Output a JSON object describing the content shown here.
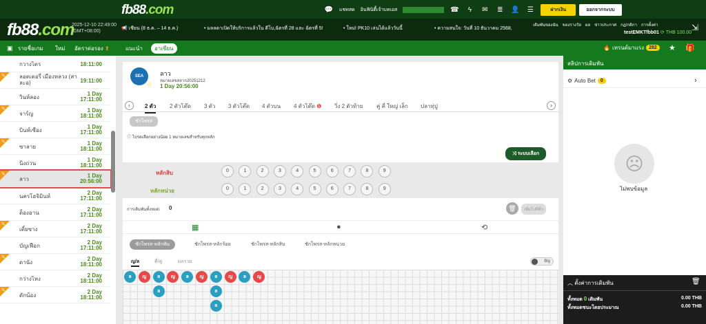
{
  "topbar": {
    "logo_main": "fb88",
    "logo_suffix": ".com",
    "links": [
      "แชทสด",
      "อินฟินิตี้เจ้าบทเอส",
      "",
      "",
      "",
      "",
      ""
    ],
    "deposit_label": "ฝากเงิน",
    "logout_label": "ออกจากระบบ"
  },
  "header": {
    "logo_main": "fb88",
    "logo_suffix": ".com",
    "datetime": "2025-12-10 22:49:00",
    "timezone": "(GMT+08:00)",
    "news": [
      "เชียน (8 ธ.ค. – 14 ธ.ค.)",
      "มลลดาเปิดให้บริการแล้วใน ดีโบ,ฉัตรที่ 28 และ ฉัตรที่ 5!",
      "ใหม่! PK10 เล่นได้แล้ววันนี้",
      "ความสนใจ: วันที่ 10 ธันวาคม 2568,"
    ],
    "user_links": [
      "เดิมพันของฉัน",
      "ของรางวัล",
      "ผล",
      "ข่าวประกาศ",
      "กฎ/กติกา",
      "การตั้งค่า"
    ],
    "username": "testEMKTfbb01",
    "balance": "THB 100.00"
  },
  "nav": {
    "items": [
      "รายชื่อเกม",
      "ใหม่",
      "อัตราต่อรอง",
      "แนะนำ",
      "อาเซียน"
    ],
    "hot_label": "เทรนด์มาแรง",
    "hot_count": "282"
  },
  "sidebar": {
    "items": [
      {
        "name": "กวางไตร",
        "time": "18:11:00",
        "day": "",
        "flag": false
      },
      {
        "name": "ลอตเตอรี่ เมืองหลวง (สาละอ)",
        "time": "19:11:00",
        "day": "",
        "flag": true
      },
      {
        "name": "วินห์ลอง",
        "time": "17:11:00",
        "day": "1 Day",
        "flag": false
      },
      {
        "name": "จาร์ญ",
        "time": "18:11:00",
        "day": "1 Day",
        "flag": true
      },
      {
        "name": "บินห์เซือง",
        "time": "17:11:00",
        "day": "1 Day",
        "flag": false
      },
      {
        "name": "ซาลาย",
        "time": "18:11:00",
        "day": "1 Day",
        "flag": true
      },
      {
        "name": "นิงถ่วน",
        "time": "18:11:00",
        "day": "1 Day",
        "flag": false
      },
      {
        "name": "ลาว",
        "time": "20:56:00",
        "day": "1 Day",
        "flag": true
      },
      {
        "name": "นครโฮจิมินห์",
        "time": "17:11:00",
        "day": "2 Day",
        "flag": false
      },
      {
        "name": "ด็องอาน",
        "time": "17:11:00",
        "day": "2 Day",
        "flag": false
      },
      {
        "name": "เตี๋ยซาง",
        "time": "17:11:00",
        "day": "2 Day",
        "flag": true
      },
      {
        "name": "บัญเฟือก",
        "time": "17:11:00",
        "day": "2 Day",
        "flag": false
      },
      {
        "name": "ดานัง",
        "time": "18:11:00",
        "day": "2 Day",
        "flag": true
      },
      {
        "name": "กว่างไหง",
        "time": "18:11:00",
        "day": "2 Day",
        "flag": false
      },
      {
        "name": "ดักน้อง",
        "time": "18:11:00",
        "day": "2 Day",
        "flag": true
      }
    ]
  },
  "main": {
    "lotto_logo": "SEA",
    "lotto_name": "ลาว",
    "round": "หมายเลขสลาก20251212",
    "countdown": "1 Day 20:56:00",
    "tabs": [
      "2 ตัว",
      "2 ตัวโต๊ด",
      "3 ตัว",
      "3 ตัวโต๊ด",
      "4 ตัวบน",
      "4 ตัวโต๊ด",
      "วิ่ง 2 ตัวท้าย",
      "คู่ คี่ ใหญ่ เล็ก",
      "ปลาทุ่ปู"
    ],
    "chip_label": "ชักไพร่ส",
    "info": "โปรดเลือกอย่างน้อย 1 หมายเลขสำหรับทุกหลัก",
    "random_label": "ระบบเลือก",
    "rows": [
      {
        "label": "หลักสิบ",
        "color": "#d94040"
      },
      {
        "label": "หลักหน่วย",
        "color": "#7aa82b"
      }
    ],
    "digits": [
      "0",
      "1",
      "2",
      "3",
      "4",
      "5",
      "6",
      "7",
      "8",
      "9"
    ],
    "total_label": "การเดิมพันทั้งหมด:",
    "total_value": "0",
    "add_slip_label": "เพิ่มไปที่ตั๋ว",
    "subtabs": [
      "ชักไพร่ส-หลักพัน",
      "ชักไพร่ส-หลักร้อย",
      "ชักไพร่ส-หลักสิบ",
      "ชักไพร่ส-หลักหน่วย"
    ],
    "filters": [
      "ญ/ล",
      "คี่/คู่",
      "ผลรวม"
    ],
    "toggle_label": "Big",
    "beads": [
      [
        {
          "t": "ล",
          "c": "o"
        }
      ],
      [
        {
          "t": "ญ",
          "c": "e"
        }
      ],
      [
        {
          "t": "ล",
          "c": "o"
        },
        {
          "t": "ล",
          "c": "o"
        }
      ],
      [
        {
          "t": "ญ",
          "c": "e"
        }
      ],
      [
        {
          "t": "ล",
          "c": "o"
        }
      ],
      [
        {
          "t": "ญ",
          "c": "e"
        }
      ],
      [
        {
          "t": "ล",
          "c": "o"
        },
        {
          "t": "ล",
          "c": "o"
        },
        {
          "t": "ล",
          "c": "o"
        }
      ],
      [
        {
          "t": "ญ",
          "c": "e"
        }
      ],
      [
        {
          "t": "ล",
          "c": "o"
        }
      ],
      [
        {
          "t": "ญ",
          "c": "e"
        }
      ]
    ]
  },
  "right_panel": {
    "title": "สลิปการเดิมพัน",
    "autobet_label": "Auto Bet",
    "autobet_count": "0",
    "empty_label": "ไม่พบข้อมูล"
  },
  "bet_settings": {
    "title": "ตั้งค่าการเดิมพัน",
    "total_label": "ทั้งหมด",
    "total_count": "0",
    "total_suffix": "เดิมพัน",
    "total_value": "0.00 THB",
    "estimate_label": "ทั้งหมดชนะโดยประมาณ",
    "estimate_value": "0.00 THB"
  },
  "colors": {
    "header_green": "#0b2a0e",
    "nav_green": "#157a1e",
    "accent_yellow": "#f5d300",
    "bead_blue": "#2a9fc2",
    "bead_red": "#e84848",
    "time_green": "#4a8a1d"
  }
}
